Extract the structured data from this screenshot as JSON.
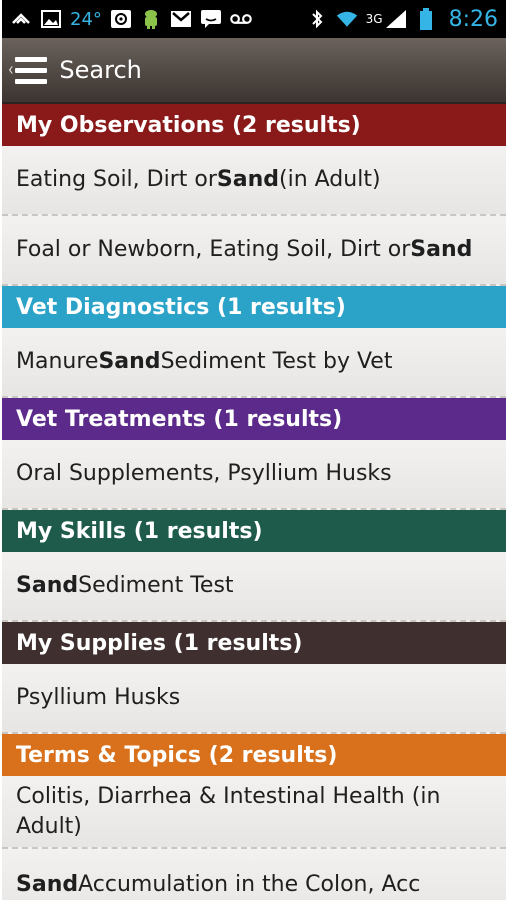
{
  "status_bar": {
    "temperature": "24°",
    "network": "3G",
    "time": "8:26"
  },
  "action_bar": {
    "title": "Search"
  },
  "sections": [
    {
      "header": "My Observations (2 results)",
      "color": "#8a1a1a",
      "items": [
        [
          {
            "t": "Eating Soil, Dirt or "
          },
          {
            "t": "Sand",
            "b": true
          },
          {
            "t": " (in Adult)"
          }
        ],
        [
          {
            "t": "Foal or Newborn, Eating Soil, Dirt or "
          },
          {
            "t": "Sand",
            "b": true
          }
        ]
      ]
    },
    {
      "header": "Vet Diagnostics (1 results)",
      "color": "#2ba3c8",
      "items": [
        [
          {
            "t": "Manure "
          },
          {
            "t": "Sand",
            "b": true
          },
          {
            "t": " Sediment Test by Vet"
          }
        ]
      ]
    },
    {
      "header": "Vet Treatments (1 results)",
      "color": "#5b2a8a",
      "items": [
        [
          {
            "t": "Oral Supplements, Psyllium Husks"
          }
        ]
      ]
    },
    {
      "header": "My Skills (1 results)",
      "color": "#1e5b4b",
      "items": [
        [
          {
            "t": "Sand",
            "b": true
          },
          {
            "t": " Sediment Test"
          }
        ]
      ]
    },
    {
      "header": "My Supplies (1 results)",
      "color": "#3f2f2f",
      "items": [
        [
          {
            "t": "Psyllium Husks"
          }
        ]
      ]
    },
    {
      "header": "Terms & Topics (2 results)",
      "color": "#d8701c",
      "items": [
        [
          {
            "t": "Colitis, Diarrhea & Intestinal Health (in Adult)"
          }
        ],
        [
          {
            "t": "Sand",
            "b": true
          },
          {
            "t": " Accumulation in the Colon, Acc"
          }
        ]
      ]
    }
  ]
}
